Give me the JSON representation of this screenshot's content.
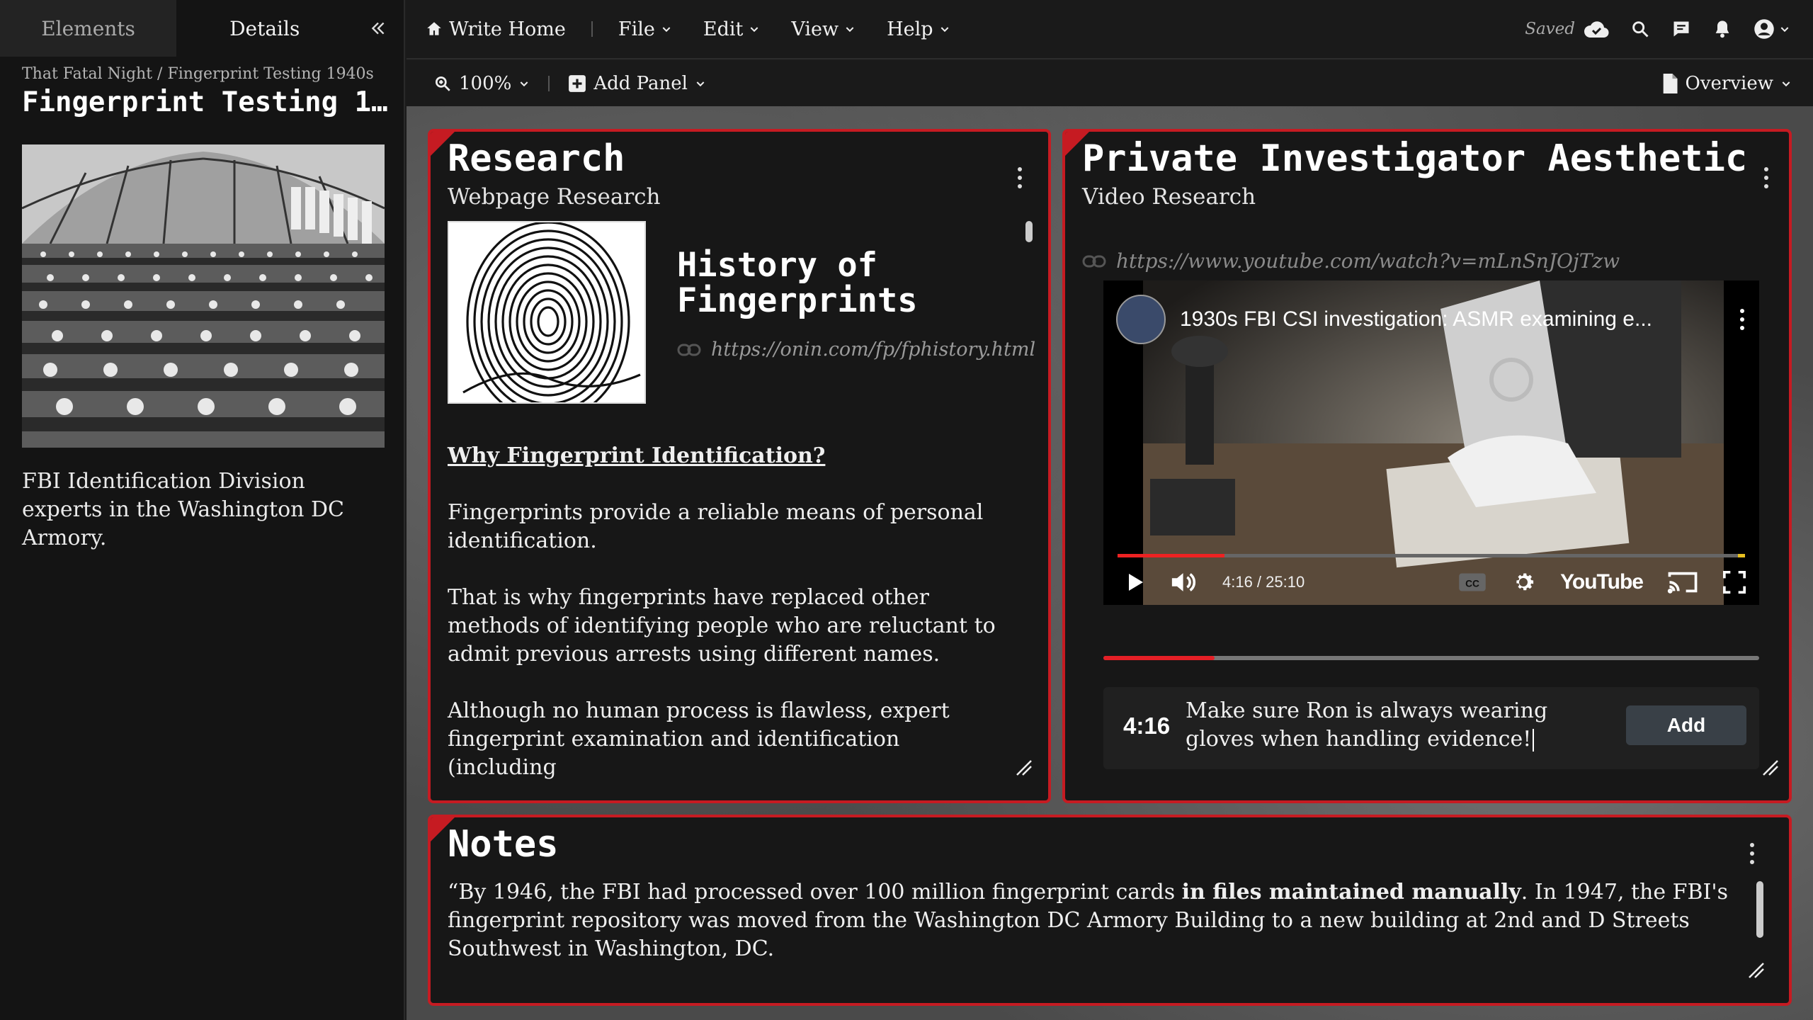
{
  "sidebar": {
    "tabs": [
      "Elements",
      "Details"
    ],
    "breadcrumb": "That Fatal Night / Fingerprint Testing 1940s",
    "title": "Fingerprint Testing 1...",
    "caption": "FBI Identification Division experts in the Washington DC Armory."
  },
  "menubar": {
    "home": "Write Home",
    "menus": [
      "File",
      "Edit",
      "View",
      "Help"
    ],
    "saved": "Saved"
  },
  "toolbar": {
    "zoom": "100%",
    "add_panel": "Add Panel",
    "overview": "Overview"
  },
  "research": {
    "title": "Research",
    "subtitle": "Webpage Research",
    "page_title": "History of Fingerprints",
    "page_url": "https://onin.com/fp/fphistory.html",
    "heading": "Why Fingerprint Identification?",
    "paragraphs": [
      "Fingerprints provide a reliable means of personal identification.",
      "That is why fingerprints have replaced other methods of identifying people who are reluctant to admit previous arrests using different names.",
      "Although no human process is flawless, expert fingerprint examination and identification (including"
    ]
  },
  "video": {
    "title": "Private Investigator Aesthetic",
    "subtitle": "Video Research",
    "url": "https://www.youtube.com/watch?v=mLnSnJOjTzw",
    "video_title": "1930s FBI CSI investigation: ASMR examining e...",
    "time": "4:16 / 25:10",
    "brand": "YouTube",
    "progress": 0.17,
    "note_time": "4:16",
    "note_text": "Make sure Ron is always wearing gloves when handling evidence!",
    "add_label": "Add"
  },
  "notes": {
    "title": "Notes",
    "text_before": "“By 1946, the FBI had processed over 100 million fingerprint cards ",
    "text_bold": "in files maintained manually",
    "text_after": ". In 1947, the FBI's fingerprint repository was moved from the Washington DC Armory Building to a new building at 2nd and D Streets Southwest in Washington, DC."
  },
  "colors": {
    "accent": "#c61b22",
    "panel_bg": "#171717",
    "button": "#394047"
  }
}
